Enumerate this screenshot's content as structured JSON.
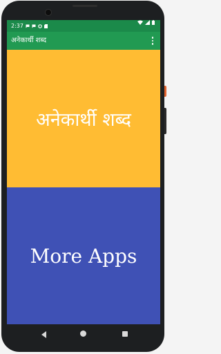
{
  "status_bar": {
    "time": "2:37",
    "left_icons": [
      "chat-icon",
      "chat-icon",
      "settings-icon",
      "sd-card-icon"
    ],
    "right_icons": [
      "wifi-icon",
      "signal-icon",
      "battery-icon"
    ]
  },
  "app_bar": {
    "title": "अनेकार्थी शब्द",
    "menu_icon": "overflow-menu-icon"
  },
  "tiles": {
    "top_label": "अनेकार्थी शब्द",
    "bottom_label": "More Apps"
  },
  "colors": {
    "status_bar": "#1b8a4a",
    "app_bar": "#219a52",
    "top_tile": "#ffbc33",
    "bottom_tile": "#3f51b5"
  },
  "nav_bar": {
    "icons": [
      "back-icon",
      "home-icon",
      "recents-icon"
    ]
  }
}
